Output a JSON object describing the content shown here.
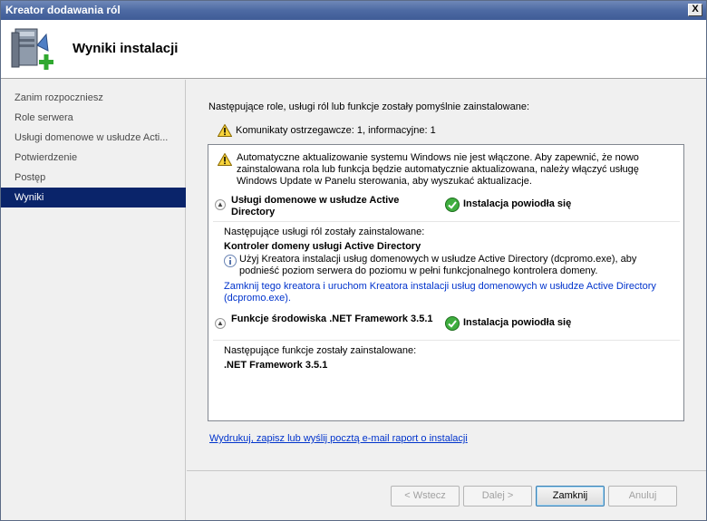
{
  "window": {
    "title": "Kreator dodawania ról",
    "close": "X"
  },
  "header": {
    "title": "Wyniki instalacji"
  },
  "sidebar": {
    "items": [
      {
        "label": "Zanim rozpoczniesz"
      },
      {
        "label": "Role serwera"
      },
      {
        "label": "Usługi domenowe w usłudze Acti..."
      },
      {
        "label": "Potwierdzenie"
      },
      {
        "label": "Postęp"
      },
      {
        "label": "Wyniki",
        "active": true
      }
    ]
  },
  "main": {
    "intro": "Następujące role, usługi ról lub funkcje zostały pomyślnie zainstalowane:",
    "summary": "Komunikaty ostrzegawcze: 1, informacyjne: 1",
    "warning": "Automatyczne aktualizowanie systemu Windows nie jest włączone. Aby zapewnić, że nowo zainstalowana rola lub funkcja będzie automatycznie aktualizowana, należy włączyć usługę Windows Update w Panelu sterowania, aby wyszukać aktualizacje.",
    "sections": [
      {
        "title": "Usługi domenowe w usłudze Active Directory",
        "status": "Instalacja powiodła się",
        "installed_caption": "Następujące usługi ról zostały zainstalowane:",
        "item": "Kontroler domeny usługi Active Directory",
        "info": "Użyj Kreatora instalacji usług domenowych w usłudze Active Directory (dcpromo.exe), aby podnieść poziom serwera do poziomu w pełni funkcjonalnego kontrolera domeny.",
        "link": "Zamknij tego kreatora i uruchom Kreatora instalacji usług domenowych w usłudze Active Directory (dcpromo.exe)."
      },
      {
        "title": "Funkcje środowiska .NET Framework 3.5.1",
        "status": "Instalacja powiodła się",
        "installed_caption": "Następujące funkcje zostały zainstalowane:",
        "item": ".NET Framework 3.5.1"
      }
    ],
    "report_link": "Wydrukuj, zapisz lub wyślij pocztą e-mail raport o instalacji"
  },
  "footer": {
    "back": "< Wstecz",
    "next": "Dalej >",
    "close": "Zamknij",
    "cancel": "Anuluj"
  }
}
